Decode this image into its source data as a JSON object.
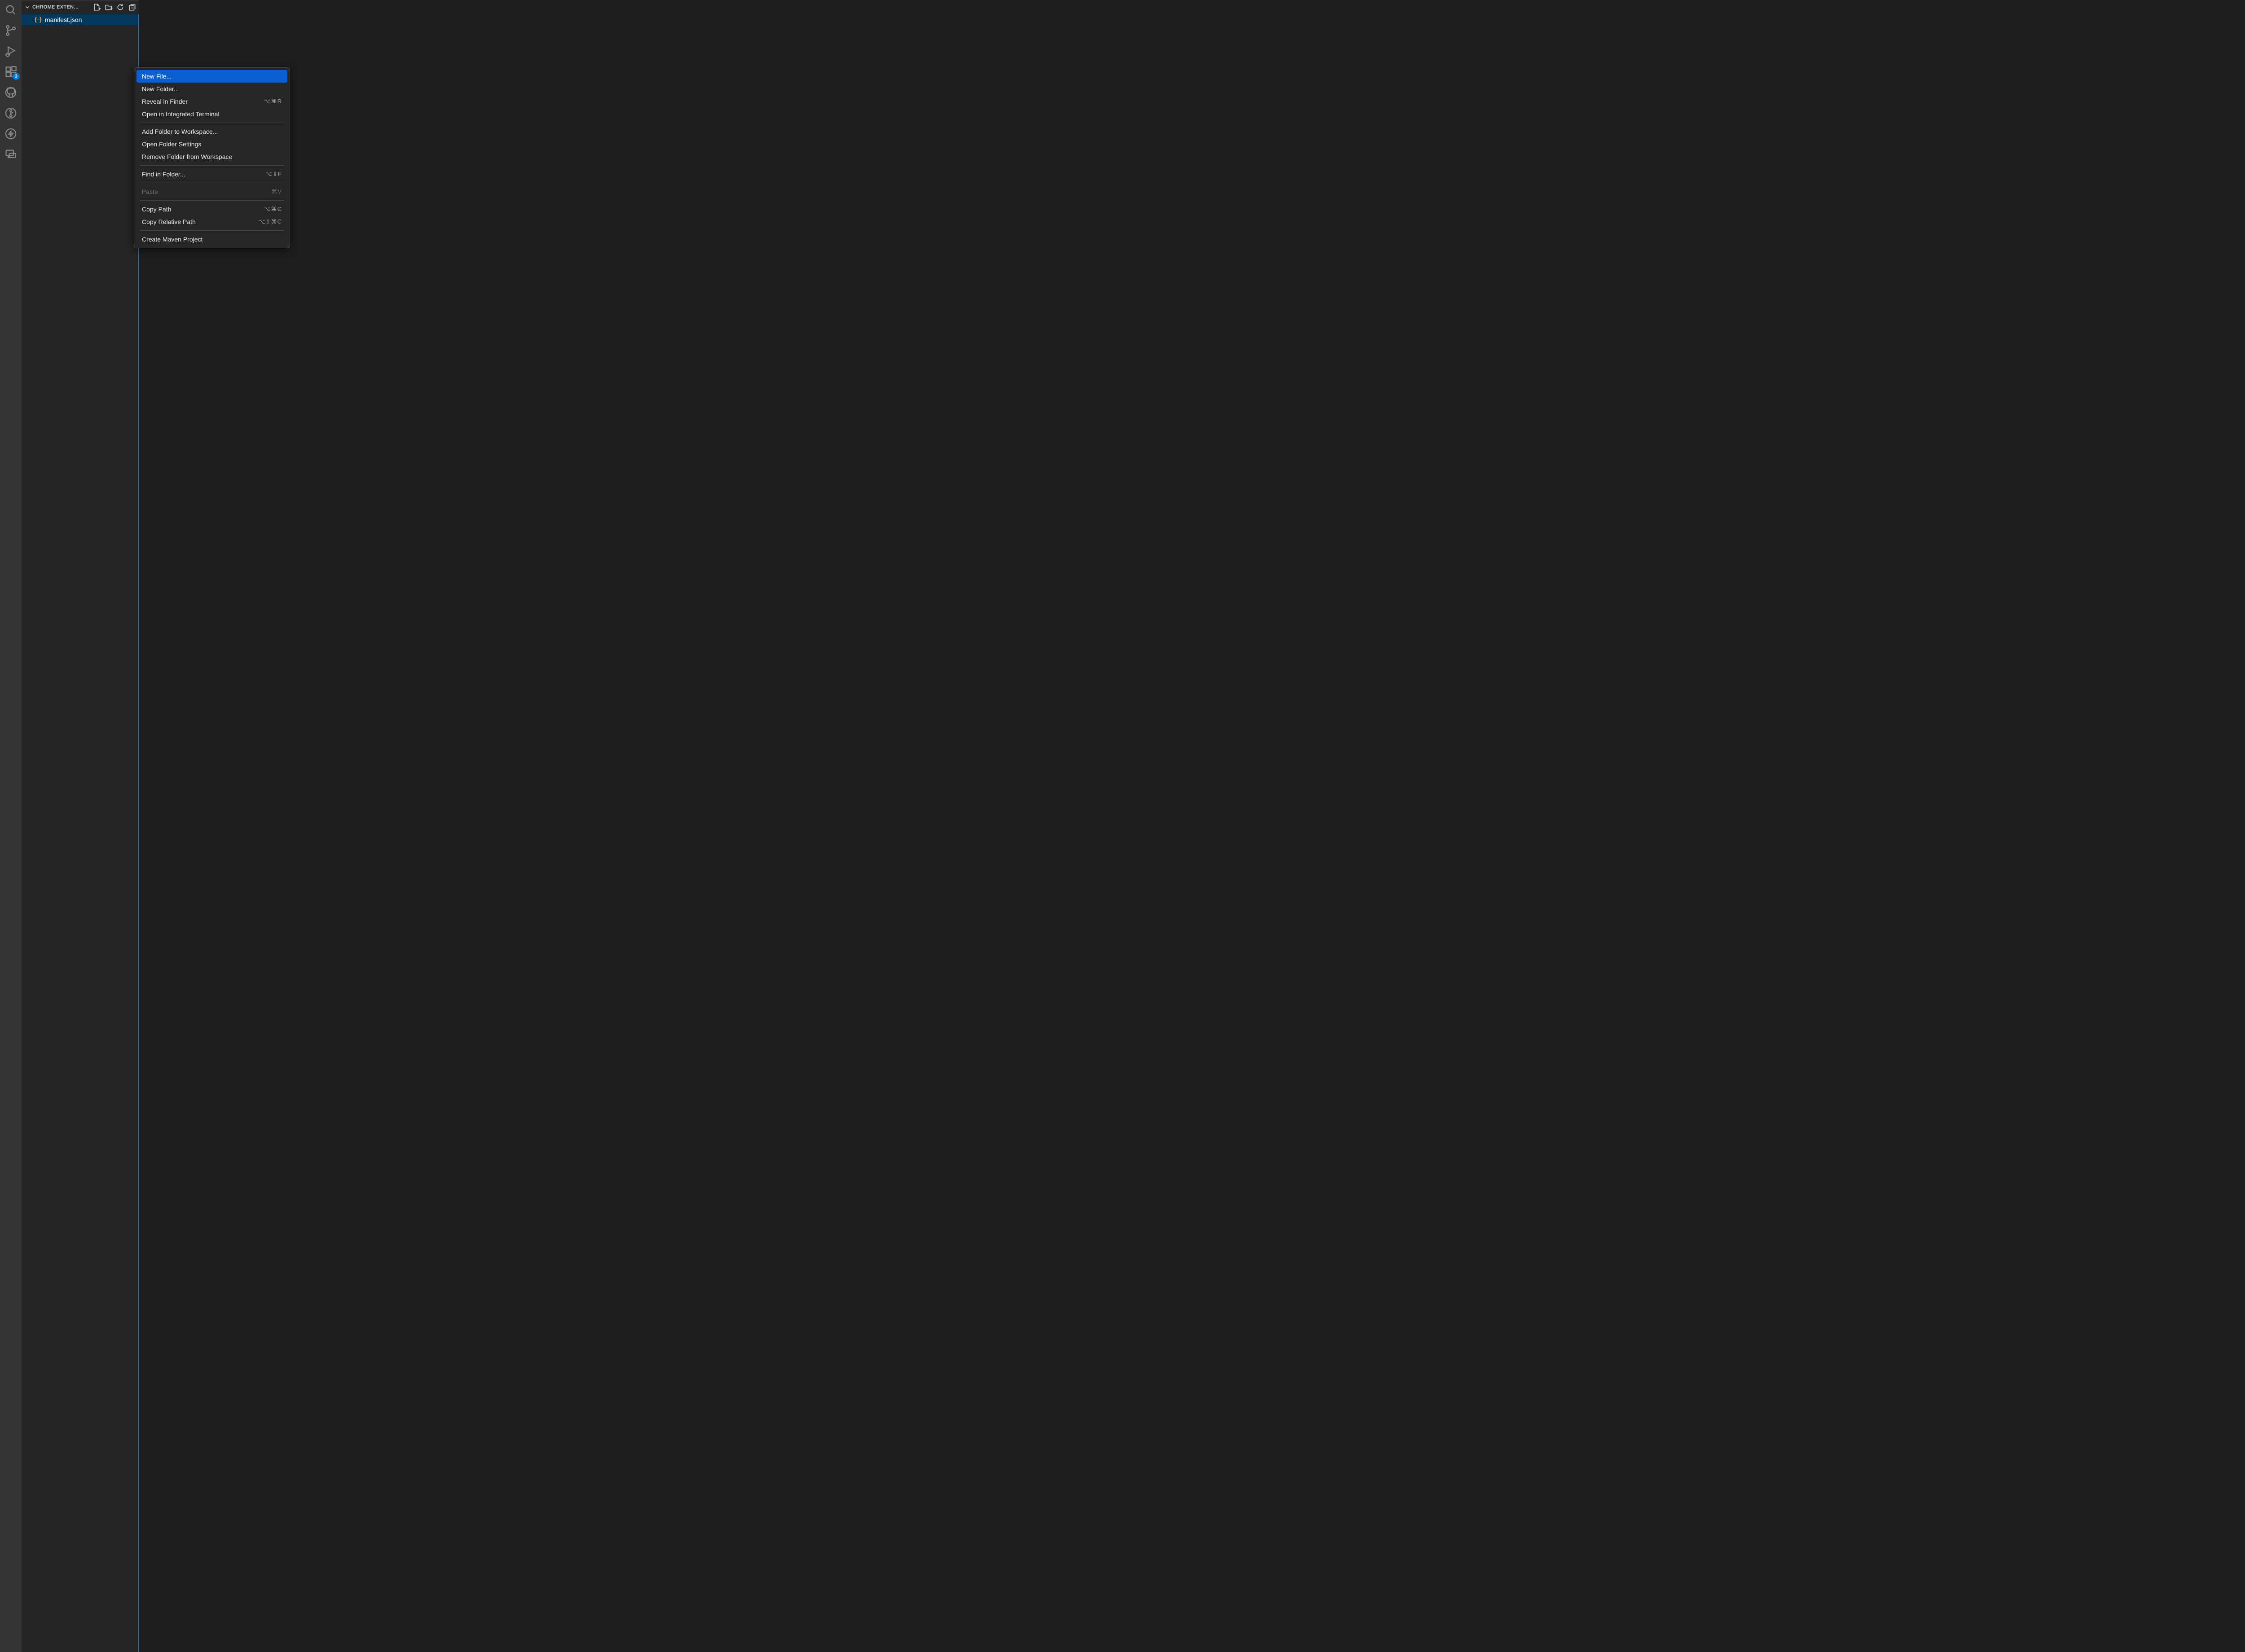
{
  "activity": {
    "extensions_badge": "3"
  },
  "explorer": {
    "section_title": "CHROME EXTEN…",
    "files": [
      {
        "name": "manifest.json"
      }
    ]
  },
  "context_menu": {
    "groups": [
      [
        {
          "label": "New File...",
          "shortcut": "",
          "highlight": true
        },
        {
          "label": "New Folder...",
          "shortcut": ""
        },
        {
          "label": "Reveal in Finder",
          "shortcut": "⌥⌘R"
        },
        {
          "label": "Open in Integrated Terminal",
          "shortcut": ""
        }
      ],
      [
        {
          "label": "Add Folder to Workspace...",
          "shortcut": ""
        },
        {
          "label": "Open Folder Settings",
          "shortcut": ""
        },
        {
          "label": "Remove Folder from Workspace",
          "shortcut": ""
        }
      ],
      [
        {
          "label": "Find in Folder...",
          "shortcut": "⌥⇧F"
        }
      ],
      [
        {
          "label": "Paste",
          "shortcut": "⌘V",
          "disabled": true
        }
      ],
      [
        {
          "label": "Copy Path",
          "shortcut": "⌥⌘C"
        },
        {
          "label": "Copy Relative Path",
          "shortcut": "⌥⇧⌘C"
        }
      ],
      [
        {
          "label": "Create Maven Project",
          "shortcut": ""
        }
      ]
    ]
  }
}
